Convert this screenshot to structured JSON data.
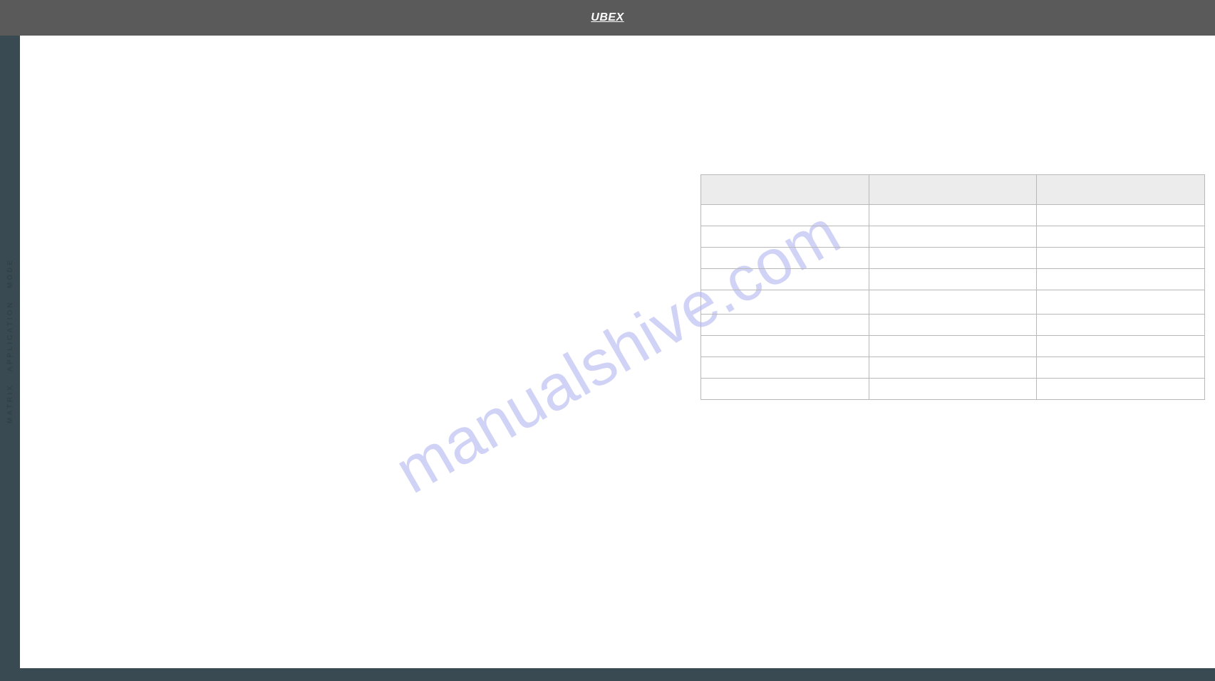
{
  "header": {
    "logo_text": "UBEX"
  },
  "sidebar": {
    "vertical_label": "MATRIX   APPLICATION   MODE"
  },
  "watermark": {
    "text": "manualshive.com"
  },
  "table": {
    "headers": [
      "",
      "",
      ""
    ],
    "rows": [
      [
        "",
        "",
        ""
      ],
      [
        "",
        "",
        ""
      ],
      [
        "",
        "",
        ""
      ],
      [
        "",
        "",
        ""
      ],
      [
        "",
        "",
        ""
      ],
      [
        "",
        "",
        ""
      ],
      [
        "",
        "",
        ""
      ],
      [
        "",
        "",
        ""
      ],
      [
        "",
        "",
        ""
      ]
    ]
  }
}
